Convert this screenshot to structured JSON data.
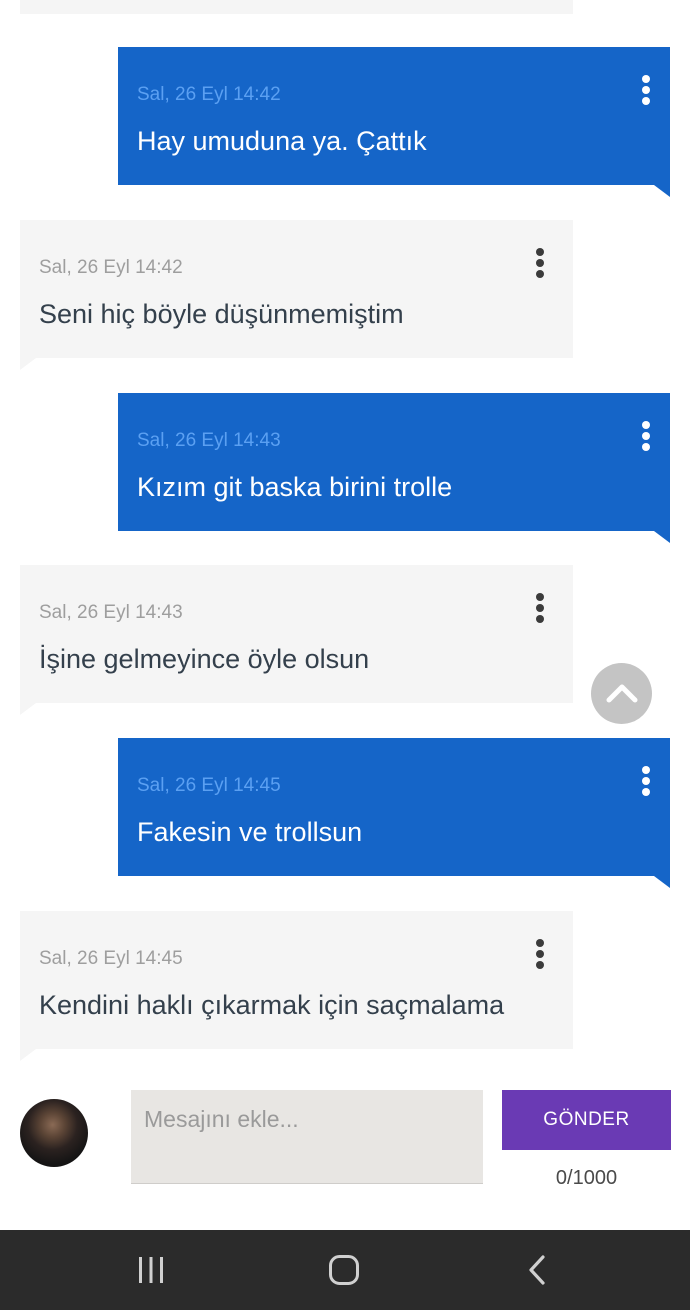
{
  "messages": [
    {
      "side": "sent",
      "timestamp": "Sal, 26 Eyl 14:42",
      "text": "Hay umuduna ya. Çattık"
    },
    {
      "side": "received",
      "timestamp": "Sal, 26 Eyl 14:42",
      "text": "Seni hiç böyle düşünmemiştim"
    },
    {
      "side": "sent",
      "timestamp": "Sal, 26 Eyl 14:43",
      "text": "Kızım git baska birini trolle"
    },
    {
      "side": "received",
      "timestamp": "Sal, 26 Eyl 14:43",
      "text": "İşine gelmeyince öyle olsun"
    },
    {
      "side": "sent",
      "timestamp": "Sal, 26 Eyl 14:45",
      "text": "Fakesin ve trollsun"
    },
    {
      "side": "received",
      "timestamp": "Sal, 26 Eyl 14:45",
      "text": "Kendini haklı çıkarmak için saçmalama"
    }
  ],
  "composer": {
    "placeholder": "Mesajını ekle...",
    "value": "",
    "send_label": "GÖNDER",
    "counter": "0/1000"
  },
  "icons": {
    "message_menu": "more-vertical-icon",
    "scroll_top": "chevron-up-icon",
    "nav_recents": "recent-apps-icon",
    "nav_home": "home-icon",
    "nav_back": "back-icon"
  },
  "colors": {
    "sent_bubble": "#1565c8",
    "received_bubble": "#f5f5f5",
    "send_button": "#6a3ab4",
    "nav_bar": "#2b2b2b"
  }
}
